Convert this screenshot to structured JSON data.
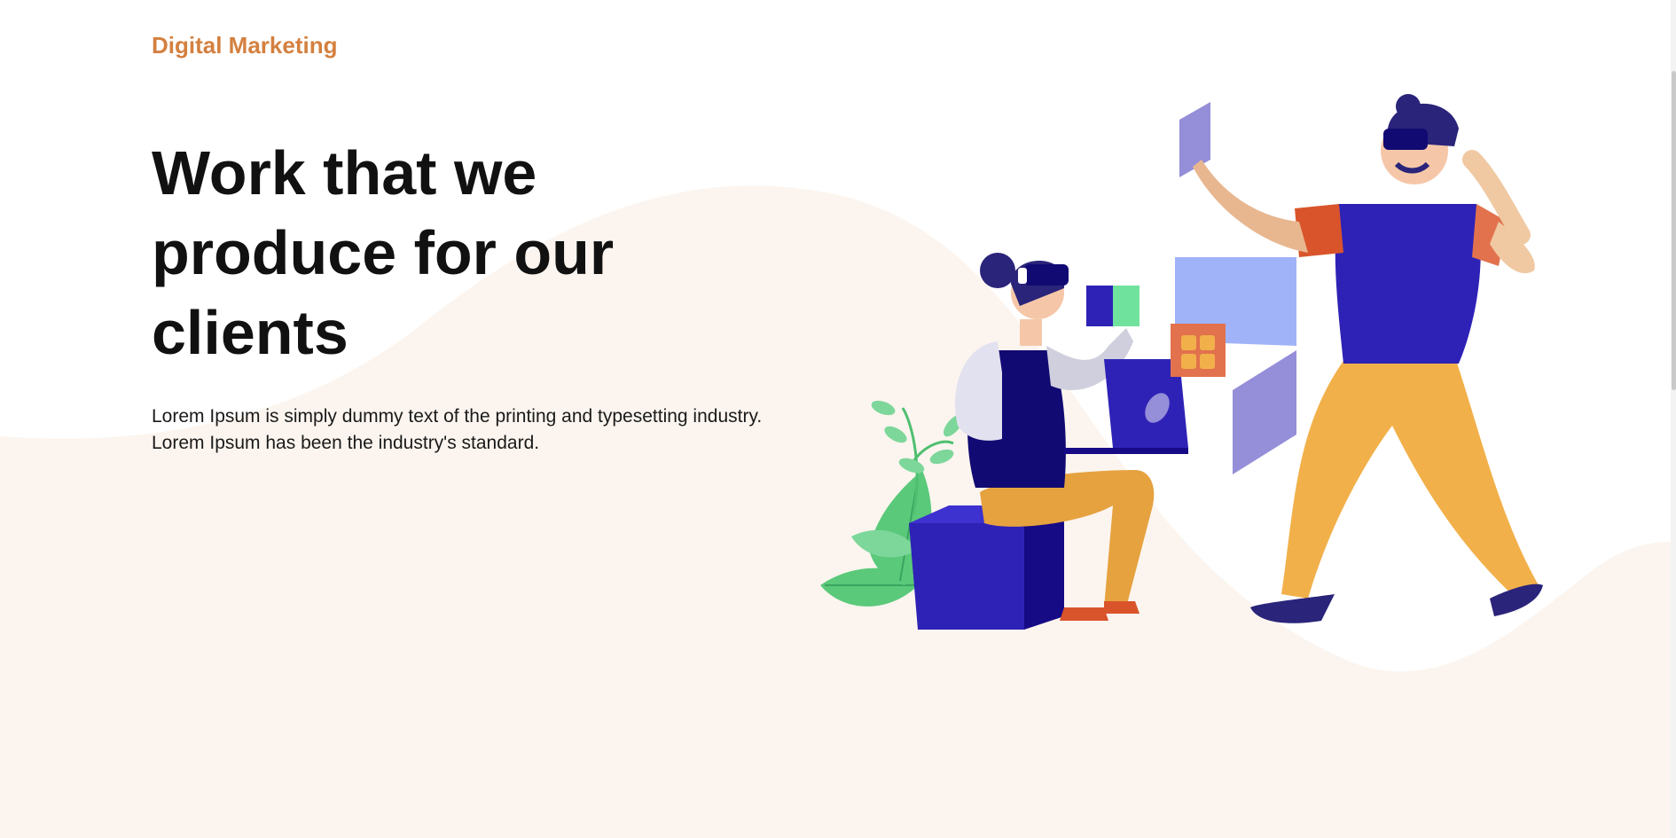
{
  "brand": "Digital Marketing",
  "hero": {
    "title": "Work that we produce for our clients",
    "description": "Lorem Ipsum is simply dummy text of the printing and typesetting industry. Lorem Ipsum has been the industry's standard."
  },
  "illustration": {
    "subject": "vr-collaboration-illustration"
  },
  "colors": {
    "brand": "#d4803f",
    "heading": "#111111",
    "wave_background": "#fcf5ef",
    "indigo": "#2e22b6",
    "orange": "#f2b04a",
    "coral": "#e0643d",
    "lavender": "#958ed8",
    "leaf_green": "#5ac97a"
  }
}
